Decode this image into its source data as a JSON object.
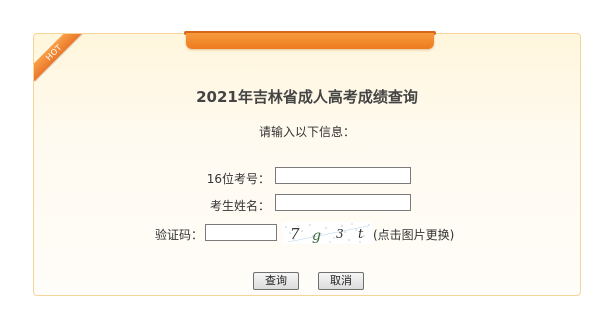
{
  "panel": {
    "badge": "HOT",
    "title": "2021年吉林省成人高考成绩查询",
    "subtitle": "请输入以下信息："
  },
  "form": {
    "exam_number_label": "16位考号：",
    "exam_number_value": "",
    "name_label": "考生姓名：",
    "name_value": "",
    "captcha_label": "验证码：",
    "captcha_value": "",
    "captcha_image_text": "7g3t",
    "captcha_hint": "(点击图片更换)"
  },
  "buttons": {
    "query": "查询",
    "cancel": "取消"
  },
  "colors": {
    "accent_orange": "#ee7a1f",
    "panel_border": "#f5d59a",
    "panel_background": "#fff6dc"
  }
}
